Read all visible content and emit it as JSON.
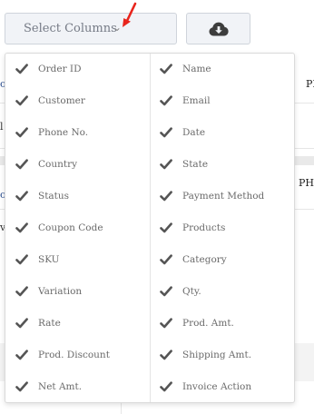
{
  "toolbar": {
    "select_label": "Select Columns",
    "select_chevron": "⌄",
    "download_icon": "cloud-download-icon"
  },
  "background": {
    "frag_right_1": "PH",
    "frag_right_2": "PH",
    "frag_left_1": "l",
    "frag_left_2": "v"
  },
  "columns": {
    "left": [
      {
        "label": "Order ID",
        "checked": true
      },
      {
        "label": "Customer",
        "checked": true
      },
      {
        "label": "Phone No.",
        "checked": true
      },
      {
        "label": "Country",
        "checked": true
      },
      {
        "label": "Status",
        "checked": true
      },
      {
        "label": "Coupon Code",
        "checked": true
      },
      {
        "label": "SKU",
        "checked": true
      },
      {
        "label": "Variation",
        "checked": true
      },
      {
        "label": "Rate",
        "checked": true
      },
      {
        "label": "Prod. Discount",
        "checked": true
      },
      {
        "label": "Net Amt.",
        "checked": true
      }
    ],
    "right": [
      {
        "label": "Name",
        "checked": true
      },
      {
        "label": "Email",
        "checked": true
      },
      {
        "label": "Date",
        "checked": true
      },
      {
        "label": "State",
        "checked": true
      },
      {
        "label": "Payment Method",
        "checked": true
      },
      {
        "label": "Products",
        "checked": true
      },
      {
        "label": "Category",
        "checked": true
      },
      {
        "label": "Qty.",
        "checked": true
      },
      {
        "label": "Prod. Amt.",
        "checked": true
      },
      {
        "label": "Shipping Amt.",
        "checked": true
      },
      {
        "label": "Invoice Action",
        "checked": true
      }
    ]
  },
  "colors": {
    "accent_arrow": "#e8241c",
    "checkmark": "#555555",
    "button_bg": "#f1f3f7"
  }
}
